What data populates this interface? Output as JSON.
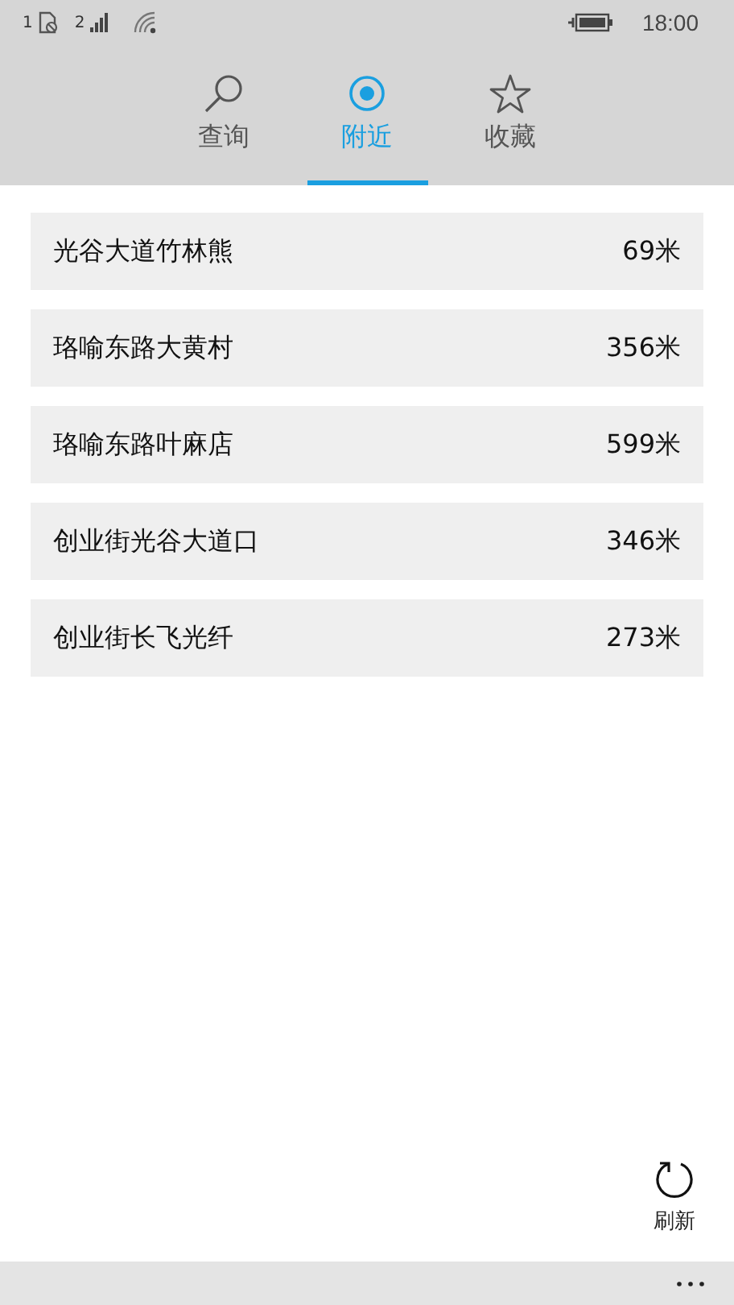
{
  "status_bar": {
    "sim1": "1",
    "sim2": "2",
    "time": "18:00"
  },
  "tabs": [
    {
      "label": "查询",
      "selected": false
    },
    {
      "label": "附近",
      "selected": true
    },
    {
      "label": "收藏",
      "selected": false
    }
  ],
  "places": [
    {
      "name": "光谷大道竹林熊",
      "distance": "69米"
    },
    {
      "name": "珞喻东路大黄村",
      "distance": "356米"
    },
    {
      "name": "珞喻东路叶麻店",
      "distance": "599米"
    },
    {
      "name": "创业街光谷大道口",
      "distance": "346米"
    },
    {
      "name": "创业街长飞光纤",
      "distance": "273米"
    }
  ],
  "refresh_button": {
    "label": "刷新"
  }
}
